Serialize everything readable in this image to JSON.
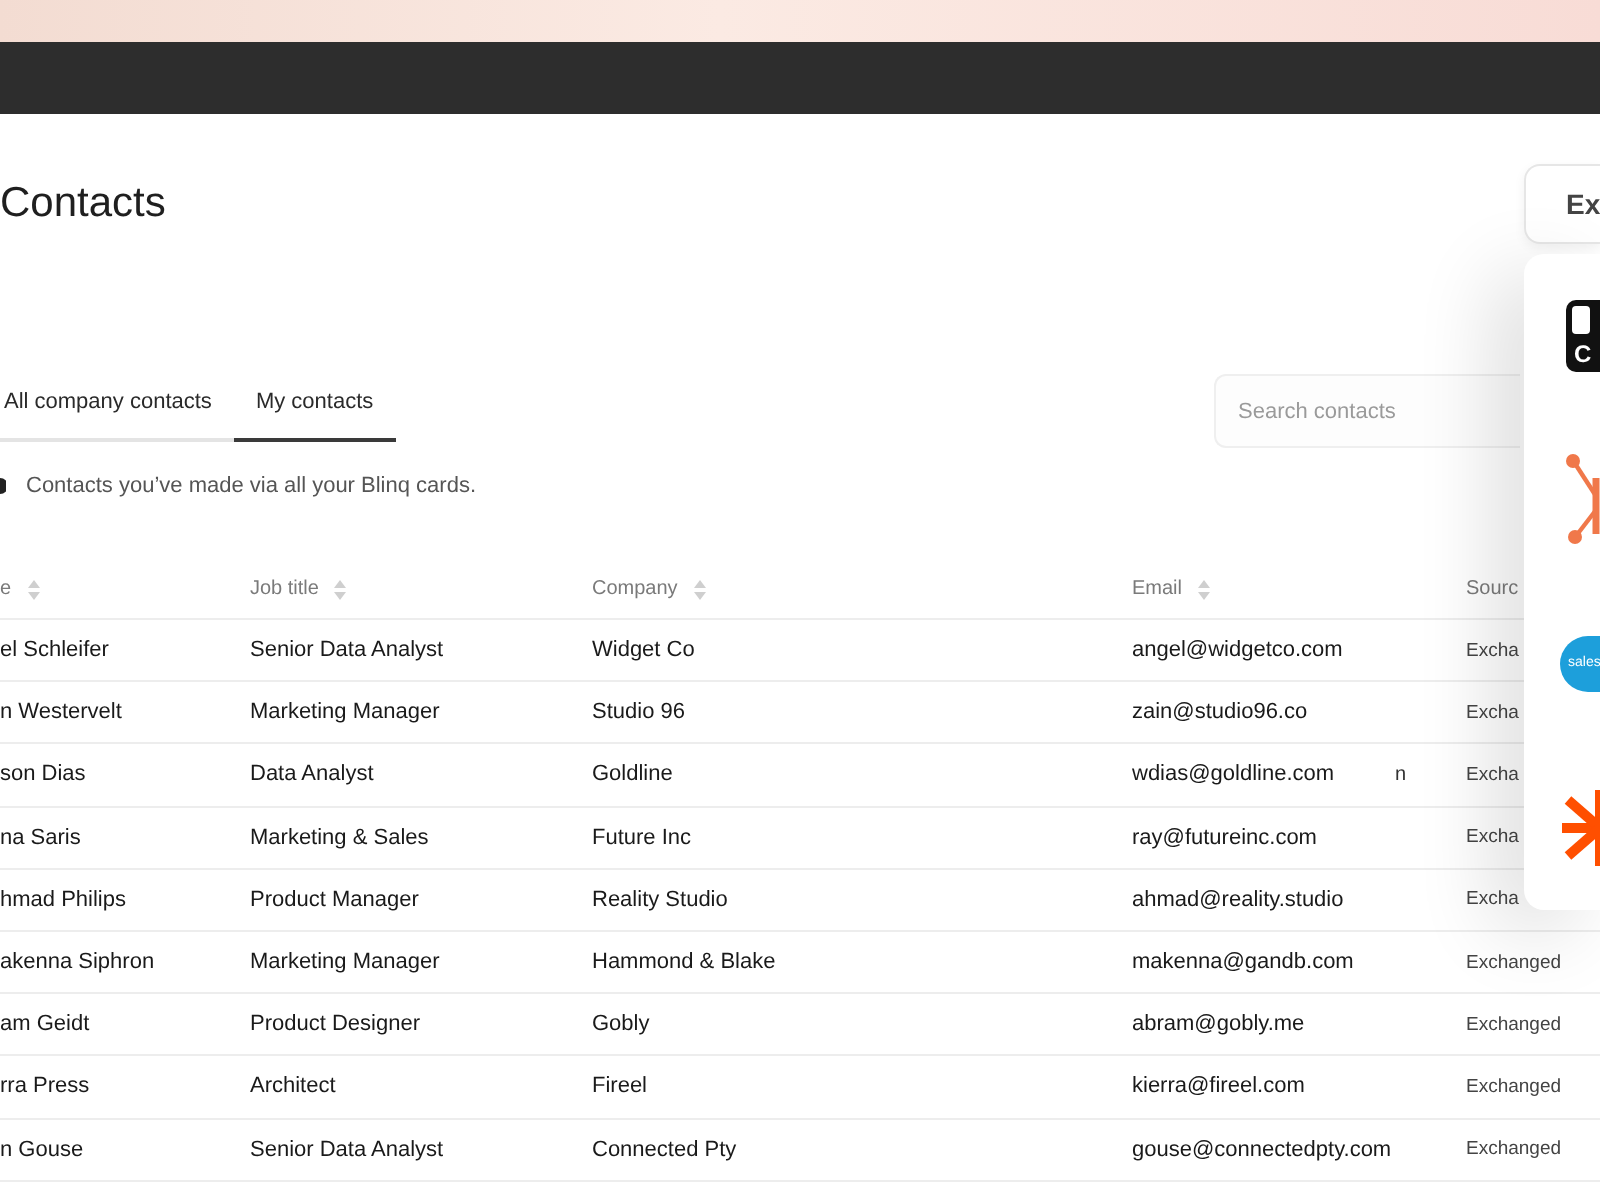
{
  "page": {
    "title": "Contacts",
    "export_button": "Ex"
  },
  "tabs": [
    {
      "label": "All company contacts",
      "selected": false
    },
    {
      "label": "My contacts",
      "selected": true
    }
  ],
  "search": {
    "placeholder": "Search contacts"
  },
  "info": "Contacts you’ve made via all your Blinq cards.",
  "table": {
    "columns": [
      {
        "label": "e",
        "sortable": true
      },
      {
        "label": "Job title",
        "sortable": true
      },
      {
        "label": "Company",
        "sortable": true
      },
      {
        "label": "Email",
        "sortable": true
      },
      {
        "label": "Sourc",
        "sortable": false
      }
    ],
    "rows": [
      {
        "cells": [
          "el Schleifer",
          "Senior Data Analyst",
          "Widget Co",
          "angel@widgetco.com",
          "Excha"
        ]
      },
      {
        "cells": [
          "n Westervelt",
          "Marketing Manager",
          "Studio 96",
          "zain@studio96.co",
          "Excha"
        ]
      },
      {
        "cells": [
          "son Dias",
          "Data Analyst",
          "Goldline",
          "wdias@goldline.com",
          "Excha"
        ],
        "stray_text": "n"
      },
      {
        "cells": [
          "na Saris",
          "Marketing & Sales",
          "Future Inc",
          "ray@futureinc.com",
          "Excha"
        ]
      },
      {
        "cells": [
          "hmad Philips",
          "Product Manager",
          "Reality Studio",
          "ahmad@reality.studio",
          "Excha"
        ]
      },
      {
        "cells": [
          "akenna Siphron",
          "Marketing Manager",
          "Hammond & Blake",
          "makenna@gandb.com",
          "Exchanged"
        ]
      },
      {
        "cells": [
          "am Geidt",
          "Product Designer",
          "Gobly",
          "abram@gobly.me",
          "Exchanged"
        ]
      },
      {
        "cells": [
          "rra Press",
          "Architect",
          "Fireel",
          "kierra@fireel.com",
          "Exchanged"
        ]
      },
      {
        "cells": [
          "n Gouse",
          "Senior Data Analyst",
          "Connected Pty",
          "gouse@connectedpty.com",
          "Exchanged"
        ]
      }
    ]
  },
  "integrations": [
    {
      "kind": "tile",
      "label": "C"
    },
    {
      "kind": "nodes"
    },
    {
      "kind": "cloud",
      "label": "sales"
    },
    {
      "kind": "asterisk"
    }
  ]
}
